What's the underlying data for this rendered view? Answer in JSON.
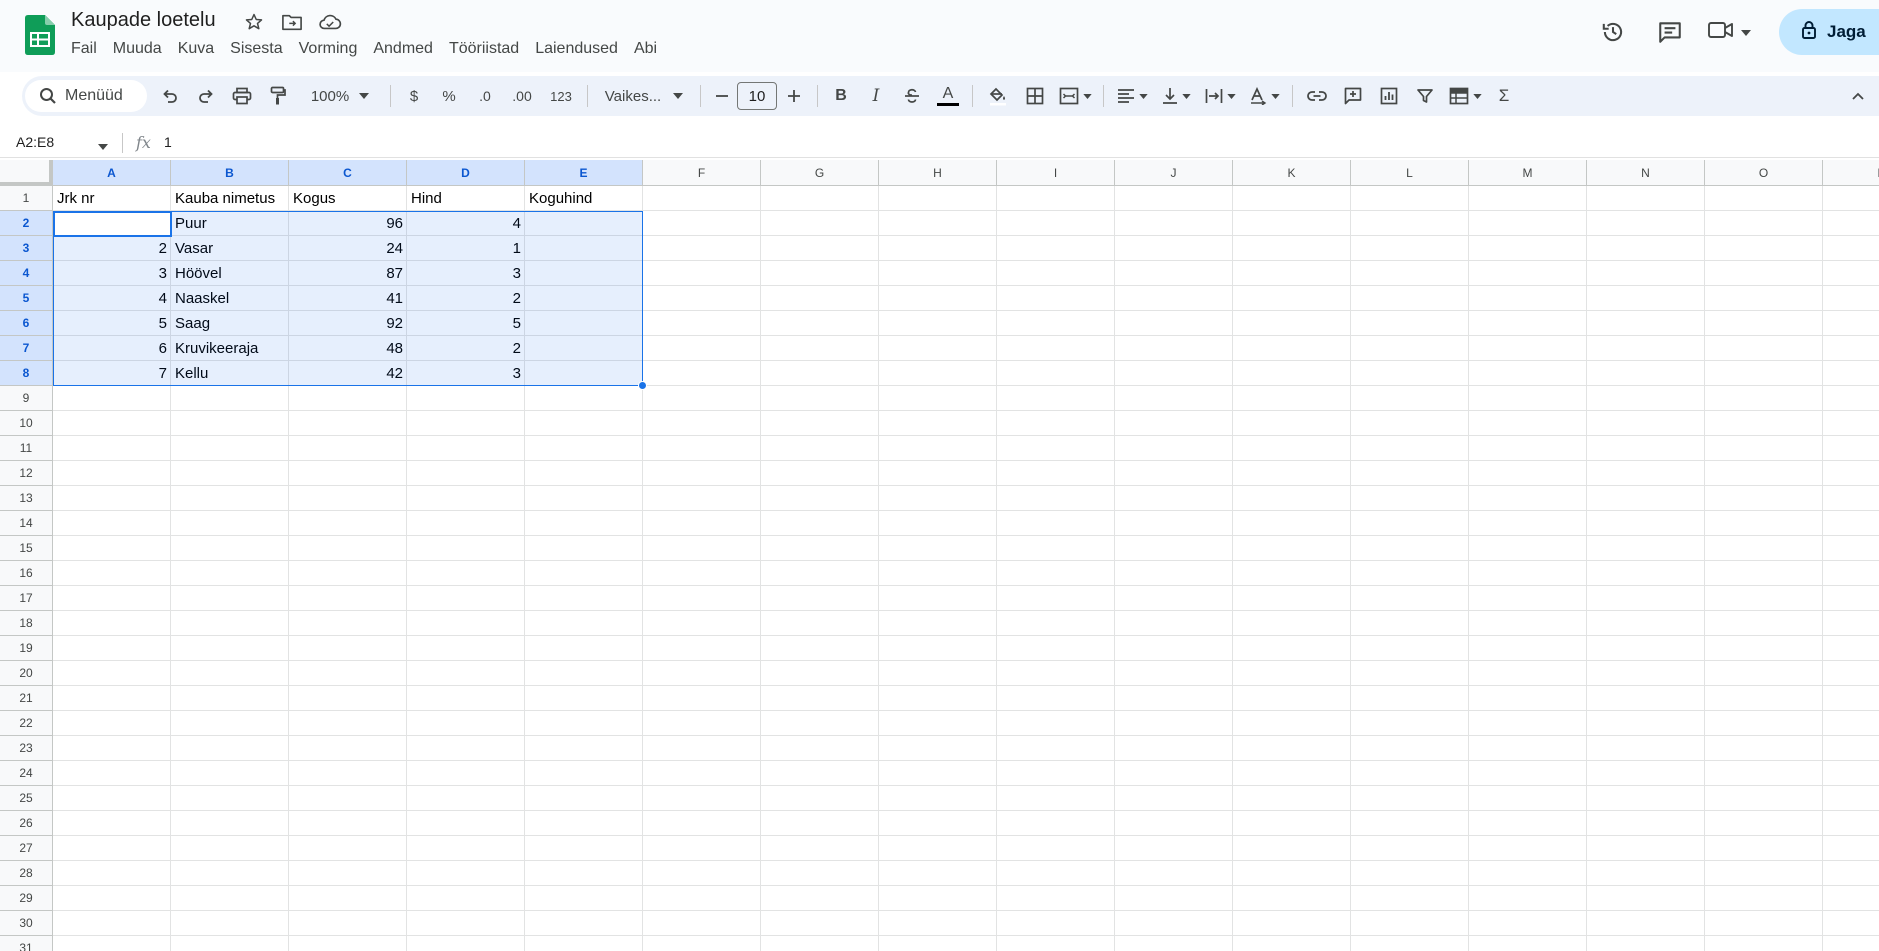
{
  "document": {
    "title": "Kaupade loetelu"
  },
  "menu": [
    "Fail",
    "Muuda",
    "Kuva",
    "Sisesta",
    "Vorming",
    "Andmed",
    "Tööriistad",
    "Laiendused",
    "Abi"
  ],
  "share": {
    "label": "Jaga"
  },
  "toolbar": {
    "search_label": "Menüüd",
    "zoom": "100%",
    "currency": "$",
    "percent": "%",
    "decrease_decimals": ".0",
    "increase_decimals": ".00",
    "number_format": "123",
    "font": "Vaikes...",
    "font_size": "10",
    "bold": "B",
    "italic": "I",
    "text_color_letter": "A",
    "sum": "Σ"
  },
  "formula_bar": {
    "name_box": "A2:E8",
    "fx": "fx",
    "value": "1"
  },
  "sheet": {
    "columns": [
      "A",
      "B",
      "C",
      "D",
      "E",
      "F",
      "G",
      "H",
      "I",
      "J",
      "K",
      "L",
      "M",
      "N",
      "O",
      "P"
    ],
    "rows": [
      "1",
      "2",
      "3",
      "4",
      "5",
      "6",
      "7",
      "8",
      "9",
      "10",
      "11",
      "12",
      "13",
      "14",
      "15",
      "16",
      "17",
      "18",
      "19",
      "20",
      "21",
      "22",
      "23",
      "24",
      "25",
      "26",
      "27",
      "28",
      "29",
      "30",
      "31"
    ],
    "header": [
      "Jrk nr",
      "Kauba nimetus",
      "Kogus",
      "Hind",
      "Koguhind"
    ],
    "data": [
      [
        "1",
        "Puur",
        "96",
        "4",
        ""
      ],
      [
        "2",
        "Vasar",
        "24",
        "1",
        ""
      ],
      [
        "3",
        "Höövel",
        "87",
        "3",
        ""
      ],
      [
        "4",
        "Naaskel",
        "41",
        "2",
        ""
      ],
      [
        "5",
        "Saag",
        "92",
        "5",
        ""
      ],
      [
        "6",
        "Kruvikeeraja",
        "48",
        "2",
        ""
      ],
      [
        "7",
        "Kellu",
        "42",
        "3",
        ""
      ]
    ]
  },
  "colors": {
    "accent": "#1a73e8",
    "share_bg": "#c2e7ff",
    "toolbar_bg": "#edf2fa",
    "sheets_green": "#0f9d58"
  }
}
